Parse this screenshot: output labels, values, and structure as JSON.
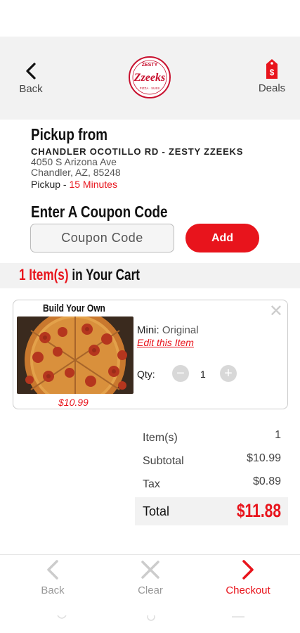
{
  "header": {
    "back_label": "Back",
    "deals_label": "Deals",
    "logo_alt": "Zesty Zzeeks"
  },
  "pickup": {
    "title": "Pickup from",
    "store_name": "CHANDLER OCOTILLO RD - ZESTY ZZEEKS",
    "address_line1": "4050 S Arizona Ave",
    "address_line2": "Chandler, AZ, 85248",
    "pickup_label": "Pickup -",
    "pickup_time": "15 Minutes"
  },
  "coupon": {
    "title": "Enter A Coupon Code",
    "placeholder": "Coupon Code",
    "add_label": "Add"
  },
  "cart": {
    "count_text": "1 Item(s)",
    "suffix_text": "in Your Cart",
    "items": [
      {
        "name": "Build Your Own",
        "price": "$10.99",
        "size_label": "Mini:",
        "size_value": "Original",
        "edit_label": "Edit this Item",
        "qty_label": "Qty:",
        "qty": "1",
        "close_glyph": "✕"
      }
    ]
  },
  "totals": {
    "items_label": "Item(s)",
    "items_value": "1",
    "subtotal_label": "Subtotal",
    "subtotal_value": "$10.99",
    "tax_label": "Tax",
    "tax_value": "$0.89",
    "total_label": "Total",
    "total_value": "$11.88"
  },
  "bottom_nav": {
    "back_label": "Back",
    "clear_label": "Clear",
    "checkout_label": "Checkout"
  },
  "colors": {
    "accent": "#e8141c",
    "header_bg": "#f2f2f2"
  }
}
